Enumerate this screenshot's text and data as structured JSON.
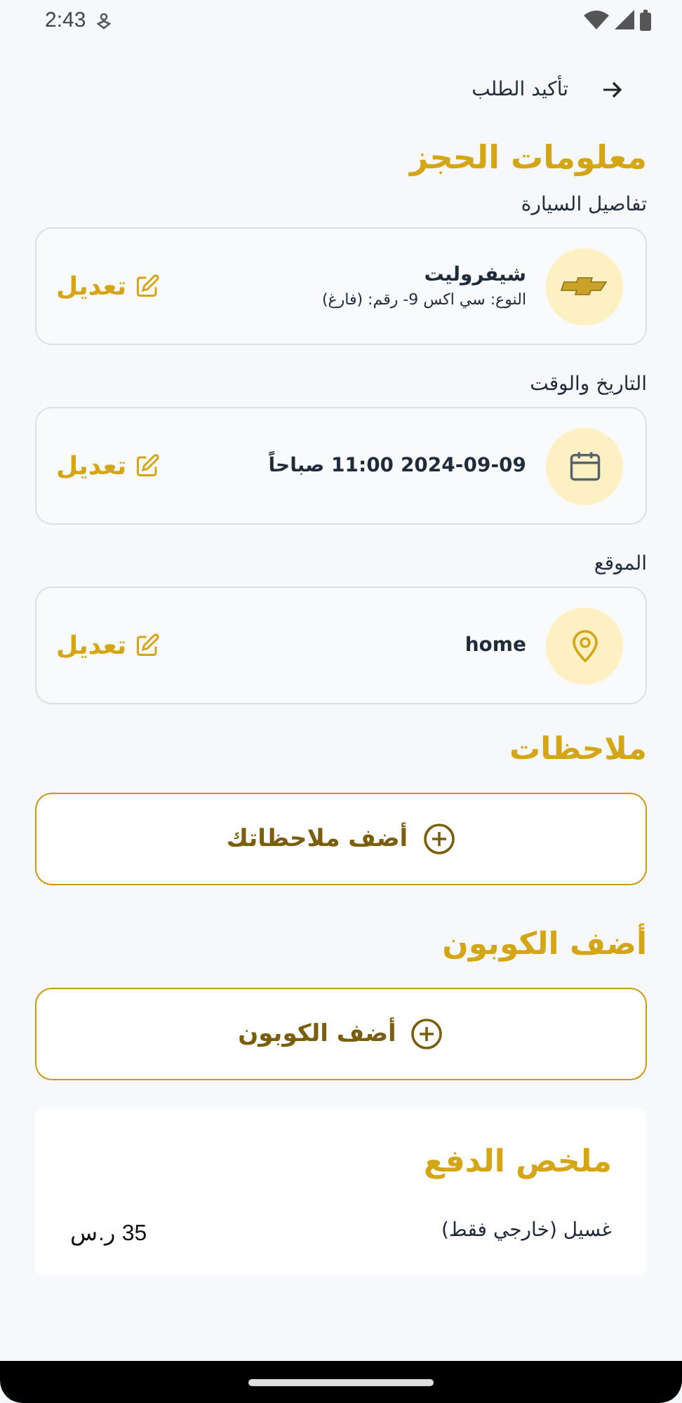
{
  "status_bar": {
    "time": "2:43"
  },
  "header": {
    "title": "تأكيد الطلب"
  },
  "booking": {
    "title": "معلومات الحجز",
    "sections": [
      {
        "label": "تفاصيل السيارة",
        "kind": "car",
        "value": "شيفروليت",
        "detail": "النوع: سي اكس 9-  رقم: (فارغ)",
        "edit": "تعديل"
      },
      {
        "label": "التاريخ والوقت",
        "kind": "calendar",
        "value": "2024-09-09 11:00 صباحاً",
        "edit": "تعديل"
      },
      {
        "label": "الموقع",
        "kind": "location",
        "value": "home",
        "edit": "تعديل"
      }
    ]
  },
  "notes": {
    "title": "ملاحظات",
    "button": "أضف ملاحظاتك"
  },
  "coupon": {
    "title": "أضف الكوبون",
    "button": "أضف الكوبون"
  },
  "payment": {
    "title": "ملخص الدفع",
    "rows": [
      {
        "label": "غسيل (خارجي فقط)",
        "amount": "35 ر.س"
      }
    ]
  }
}
